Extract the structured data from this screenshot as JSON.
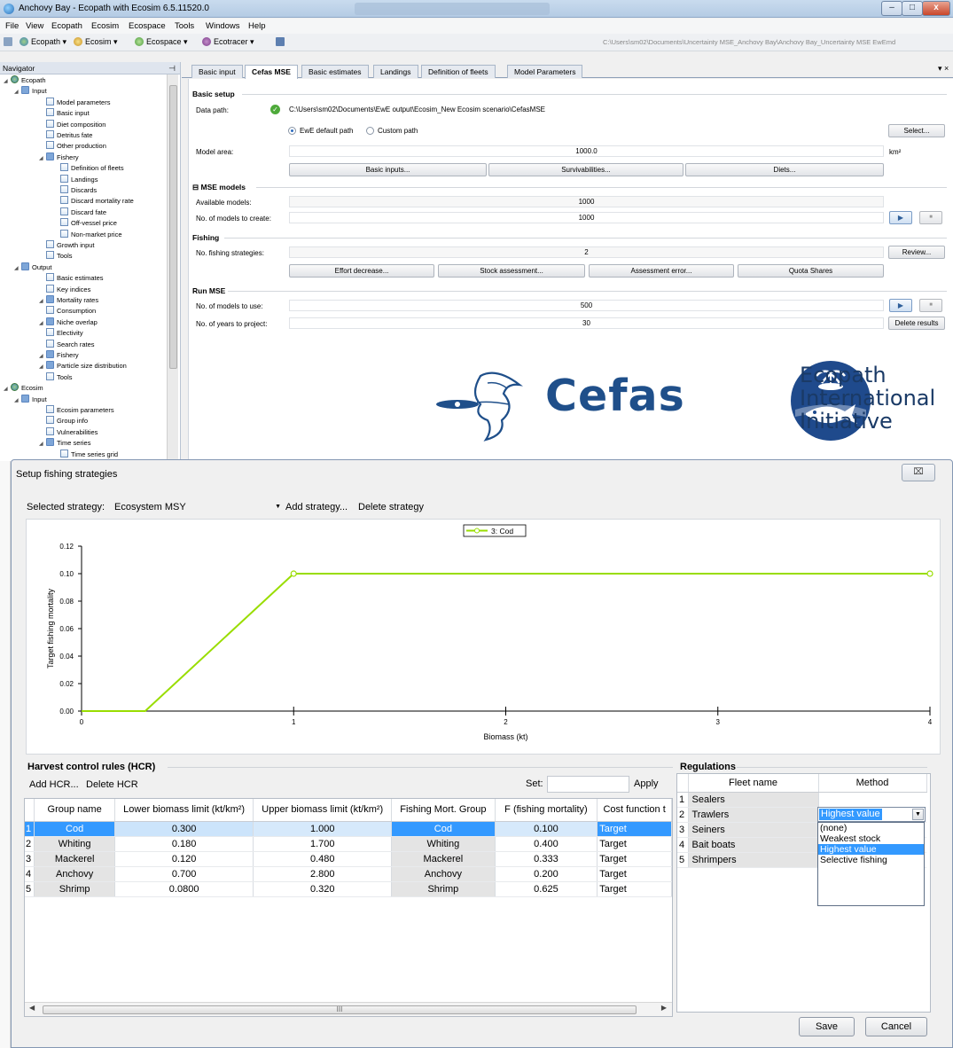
{
  "window": {
    "title": "Anchovy Bay - Ecopath with Ecosim 6.5.11520.0",
    "minimize": "–",
    "maximize": "□",
    "close": "x"
  },
  "menu": [
    "File",
    "View",
    "Ecopath",
    "Ecosim",
    "Ecospace",
    "Tools",
    "Windows",
    "Help"
  ],
  "toolbar": {
    "items": [
      "Ecopath",
      "Ecosim",
      "Ecospace",
      "Ecotracer"
    ],
    "path": "C:\\Users\\sm02\\Documents\\Uncertainty MSE_Anchovy Bay\\Anchovy Bay_Uncertainty MSE EwEmd"
  },
  "navigator": {
    "title": "Navigator",
    "tree": [
      {
        "label": "Ecopath",
        "level": 0,
        "icon": "globe"
      },
      {
        "label": "Input",
        "level": 1,
        "icon": "folder"
      },
      {
        "label": "Model parameters",
        "level": 2,
        "icon": "form"
      },
      {
        "label": "Basic input",
        "level": 2,
        "icon": "form"
      },
      {
        "label": "Diet composition",
        "level": 2,
        "icon": "form"
      },
      {
        "label": "Detritus fate",
        "level": 2,
        "icon": "form"
      },
      {
        "label": "Other production",
        "level": 2,
        "icon": "form"
      },
      {
        "label": "Fishery",
        "level": 2,
        "icon": "folder"
      },
      {
        "label": "Definition of fleets",
        "level": 3,
        "icon": "form"
      },
      {
        "label": "Landings",
        "level": 3,
        "icon": "form"
      },
      {
        "label": "Discards",
        "level": 3,
        "icon": "form"
      },
      {
        "label": "Discard mortality rate",
        "level": 3,
        "icon": "form"
      },
      {
        "label": "Discard fate",
        "level": 3,
        "icon": "form"
      },
      {
        "label": "Off-vessel price",
        "level": 3,
        "icon": "form"
      },
      {
        "label": "Non-market price",
        "level": 3,
        "icon": "form"
      },
      {
        "label": "Growth input",
        "level": 2,
        "icon": "form"
      },
      {
        "label": "Tools",
        "level": 2,
        "icon": "tools"
      },
      {
        "label": "Output",
        "level": 1,
        "icon": "folder"
      },
      {
        "label": "Basic estimates",
        "level": 2,
        "icon": "form"
      },
      {
        "label": "Key indices",
        "level": 2,
        "icon": "form"
      },
      {
        "label": "Mortality rates",
        "level": 2,
        "icon": "folder"
      },
      {
        "label": "Consumption",
        "level": 2,
        "icon": "form"
      },
      {
        "label": "Niche overlap",
        "level": 2,
        "icon": "folder"
      },
      {
        "label": "Electivity",
        "level": 2,
        "icon": "form"
      },
      {
        "label": "Search rates",
        "level": 2,
        "icon": "form"
      },
      {
        "label": "Fishery",
        "level": 2,
        "icon": "folder"
      },
      {
        "label": "Particle size distribution",
        "level": 2,
        "icon": "folder"
      },
      {
        "label": "Tools",
        "level": 2,
        "icon": "tools"
      },
      {
        "label": "Ecosim",
        "level": 0,
        "icon": "globe"
      },
      {
        "label": "Input",
        "level": 1,
        "icon": "folder"
      },
      {
        "label": "Ecosim parameters",
        "level": 2,
        "icon": "form"
      },
      {
        "label": "Group info",
        "level": 2,
        "icon": "form"
      },
      {
        "label": "Vulnerabilities",
        "level": 2,
        "icon": "form"
      },
      {
        "label": "Time series",
        "level": 2,
        "icon": "folder"
      },
      {
        "label": "Time series grid",
        "level": 3,
        "icon": "form"
      }
    ]
  },
  "tabs": [
    "Basic input",
    "Cefas MSE",
    "Basic estimates",
    "Landings",
    "Definition of fleets",
    "Model Parameters"
  ],
  "tab_close": "▾ ×",
  "mse": {
    "basic_setup": "Basic setup",
    "data_path_label": "Data path:",
    "data_path": "C:\\Users\\sm02\\Documents\\EwE output\\Ecosim_New Ecosim scenario\\CefasMSE",
    "radio_default": "EwE default path",
    "radio_custom": "Custom path",
    "select_button": "Select...",
    "model_area_label": "Model area:",
    "model_area": "1000.0",
    "model_area_unit": "km²",
    "basic_inputs_button": "Basic inputs...",
    "survivabilities_button": "Survivabilities...",
    "diets_button": "Diets...",
    "mse_models": "MSE models",
    "available_models_label": "Available models:",
    "available_models": "1000",
    "models_to_create_label": "No. of models to create:",
    "models_to_create": "1000",
    "fishing": "Fishing",
    "fishing_strategies_label": "No. fishing strategies:",
    "fishing_strategies": "2",
    "review_button": "Review...",
    "effort_button": "Effort decrease...",
    "stock_button": "Stock assessment...",
    "assessment_button": "Assessment error...",
    "quota_button": "Quota Shares",
    "run_mse": "Run MSE",
    "models_to_use_label": "No. of models to use:",
    "models_to_use": "500",
    "years_label": "No. of years to project:",
    "years": "30",
    "delete_results_button": "Delete results",
    "play_glyph": "▶",
    "stop_glyph": "■"
  },
  "logos": {
    "cefas": "Cefas",
    "eii": [
      "Ecopath",
      "International",
      "Initiative"
    ]
  },
  "dialog": {
    "title": "Setup fishing strategies",
    "close": "⌧",
    "strategy_label": "Selected strategy:",
    "strategy_value": "Ecosystem MSY",
    "add_strategy": "Add strategy...",
    "delete_strategy": "Delete strategy",
    "hcr_title": "Harvest control rules (HCR)",
    "add_hcr": "Add HCR...",
    "delete_hcr": "Delete HCR",
    "set_label": "Set:",
    "apply": "Apply",
    "regulations_title": "Regulations",
    "save": "Save",
    "cancel": "Cancel",
    "scroll_grip": "III"
  },
  "chart_data": {
    "type": "line",
    "legend": "top-center",
    "series": [
      {
        "name": "3: Cod",
        "color": "#99dd00",
        "x": [
          0,
          0.3,
          1.0,
          4.0
        ],
        "y": [
          0,
          0,
          0.1,
          0.1
        ]
      }
    ],
    "xlabel": "Biomass (kt)",
    "ylabel": "Target fishing mortality",
    "xlim": [
      0,
      4
    ],
    "ylim": [
      0,
      0.12
    ],
    "xticks": [
      "0",
      "1",
      "2",
      "3",
      "4"
    ],
    "yticks": [
      "0.00",
      "0.02",
      "0.04",
      "0.06",
      "0.08",
      "0.10",
      "0.12"
    ],
    "grid": false
  },
  "hcr_table": {
    "columns": [
      "",
      "Group name",
      "Lower biomass limit (kt/km²)",
      "Upper biomass limit (kt/km²)",
      "Fishing Mort. Group",
      "F (fishing mortality)",
      "Cost function t"
    ],
    "rows": [
      [
        "1",
        "Cod",
        "0.300",
        "1.000",
        "Cod",
        "0.100",
        "Target"
      ],
      [
        "2",
        "Whiting",
        "0.180",
        "1.700",
        "Whiting",
        "0.400",
        "Target"
      ],
      [
        "3",
        "Mackerel",
        "0.120",
        "0.480",
        "Mackerel",
        "0.333",
        "Target"
      ],
      [
        "4",
        "Anchovy",
        "0.700",
        "2.800",
        "Anchovy",
        "0.200",
        "Target"
      ],
      [
        "5",
        "Shrimp",
        "0.0800",
        "0.320",
        "Shrimp",
        "0.625",
        "Target"
      ]
    ]
  },
  "regulations_table": {
    "columns": [
      "",
      "Fleet name",
      "Method"
    ],
    "rows": [
      [
        "1",
        "Sealers",
        ""
      ],
      [
        "2",
        "Trawlers",
        "Highest value"
      ],
      [
        "3",
        "Seiners",
        ""
      ],
      [
        "4",
        "Bait boats",
        ""
      ],
      [
        "5",
        "Shrimpers",
        ""
      ]
    ],
    "method_options": [
      "(none)",
      "Weakest stock",
      "Highest value",
      "Selective fishing"
    ],
    "selected_method": "Highest value"
  }
}
